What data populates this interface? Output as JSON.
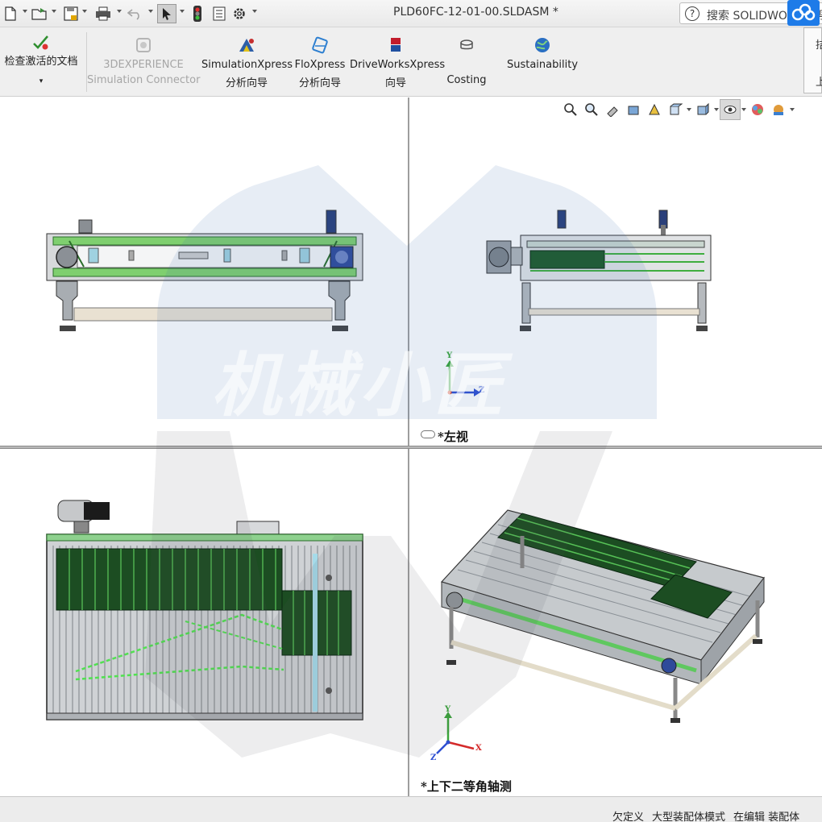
{
  "window": {
    "document_title": "PLD60FC-12-01-00.SLDASM *",
    "search_placeholder": "搜索 SOLIDWORKS 帮助"
  },
  "quick_access": [
    {
      "name": "new-document",
      "icon": "new-file-icon"
    },
    {
      "name": "open-document",
      "icon": "open-folder-icon"
    },
    {
      "name": "save",
      "icon": "save-icon"
    },
    {
      "name": "print",
      "icon": "print-icon"
    },
    {
      "name": "undo",
      "icon": "undo-icon"
    },
    {
      "name": "select",
      "icon": "cursor-icon"
    },
    {
      "name": "rebuild",
      "icon": "traffic-light-icon"
    },
    {
      "name": "file-properties",
      "icon": "properties-icon"
    },
    {
      "name": "options",
      "icon": "gear-icon"
    }
  ],
  "ribbon": {
    "check_active_doc": {
      "line1": "检查激活的文档",
      "line2": ""
    },
    "sim_connector": {
      "line1": "3DEXPERIENCE",
      "line2": "Simulation Connector"
    },
    "simulation_xpress": {
      "line1": "SimulationXpress",
      "line2": "分析向导"
    },
    "flo_xpress": {
      "line1": "FloXpress",
      "line2": "分析向导"
    },
    "driveworks_xpress": {
      "line1": "DriveWorksXpress",
      "line2": "向导"
    },
    "costing": {
      "line1": "",
      "line2": "Costing"
    },
    "sustainability": {
      "line1": "Sustainability",
      "line2": ""
    }
  },
  "side_panel": {
    "line1": "拮",
    "line2": "上"
  },
  "viewports": {
    "top_left": {
      "label": ""
    },
    "top_right": {
      "label": "*左视"
    },
    "bottom_left": {
      "label": ""
    },
    "bottom_right": {
      "label": "*上下二等角轴测"
    }
  },
  "triad": {
    "y": "Y",
    "z": "Z",
    "x": "X"
  },
  "watermark": {
    "text": "机械小匠"
  },
  "status_bar": {
    "items": [
      "欠定义",
      "大型装配体模式",
      "在编辑 装配体"
    ]
  },
  "colors": {
    "frame_green": "#3fae3f",
    "roller_gray": "#b9bcbf",
    "belt_dark_green": "#174d1f",
    "watermark_blue": "#3a6cb0",
    "accent_blue": "#1e7be8"
  }
}
